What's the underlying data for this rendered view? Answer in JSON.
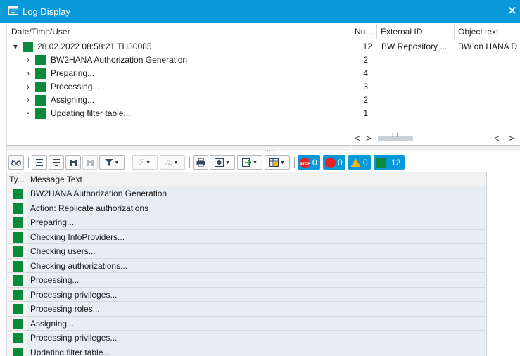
{
  "window": {
    "title": "Log Display",
    "title_icon": "log-display-icon",
    "close_glyph": "✕"
  },
  "tree": {
    "header": "Date/Time/User",
    "rows": [
      {
        "expander": "▾",
        "label": "28.02.2022  08:58:21  TH30085",
        "level": 0
      },
      {
        "expander": "›",
        "label": "BW2HANA Authorization Generation",
        "level": 1
      },
      {
        "expander": "›",
        "label": "Preparing...",
        "level": 1
      },
      {
        "expander": "›",
        "label": "Processing...",
        "level": 1
      },
      {
        "expander": "›",
        "label": "Assigning...",
        "level": 1
      },
      {
        "expander": "•",
        "label": "Updating filter table...",
        "level": 1
      }
    ],
    "status_color": "#0b8a3c"
  },
  "grid": {
    "headers": [
      "Nu...",
      "External ID",
      "Object text"
    ],
    "rows": [
      {
        "num": "12",
        "external_id": "BW Repository ...",
        "object_text": "BW on HANA D"
      },
      {
        "num": "2",
        "external_id": "",
        "object_text": ""
      },
      {
        "num": "4",
        "external_id": "",
        "object_text": ""
      },
      {
        "num": "3",
        "external_id": "",
        "object_text": ""
      },
      {
        "num": "2",
        "external_id": "",
        "object_text": ""
      },
      {
        "num": "1",
        "external_id": "",
        "object_text": ""
      }
    ],
    "scroll_left": "<",
    "scroll_right": ">",
    "scroll_thumb": "III"
  },
  "splitter_grip": ".....",
  "toolbar": {
    "detail_icon": "glasses-icon",
    "counters": [
      {
        "name": "stop",
        "count": "0",
        "color": "#e8202a"
      },
      {
        "name": "error",
        "count": "0",
        "color": "#e8202a"
      },
      {
        "name": "warning",
        "count": "0",
        "color": "#f2b21b"
      },
      {
        "name": "success",
        "count": "12",
        "color": "#0b8a3c"
      }
    ],
    "stop_label": "STOP"
  },
  "messages": {
    "headers": [
      "Ty...",
      "Message Text"
    ],
    "rows": [
      "BW2HANA Authorization Generation",
      "Action: Replicate authorizations",
      "Preparing...",
      "Checking InfoProviders...",
      "Checking users...",
      "Checking authorizations...",
      "Processing...",
      "Processing privileges...",
      "Processing roles...",
      "Assigning...",
      "Processing privileges...",
      "Updating filter table..."
    ]
  },
  "colors": {
    "accent": "#0a99d8",
    "success": "#0b8a3c",
    "row_bg": "#e6eef3"
  }
}
